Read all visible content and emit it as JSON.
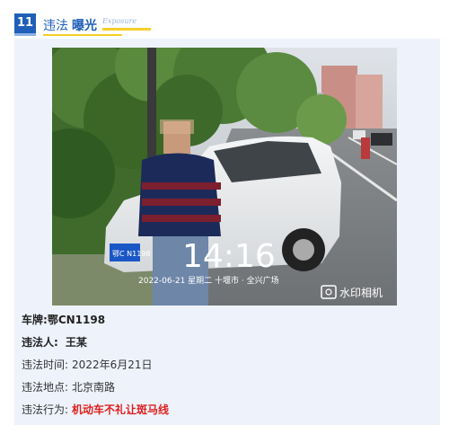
{
  "header": {
    "number": "11",
    "title_part1": "违法",
    "title_part2": "曝光",
    "title_en": "Exposure"
  },
  "photo": {
    "time_overlay": "14:16",
    "date_location": "2022-06-21  星期二  十堰市 · 全兴广场",
    "watermark_app": "水印相机",
    "plate_text": "鄂C N1198"
  },
  "details": {
    "plate_label": "车牌:",
    "plate_value": "鄂CN1198",
    "violator_label": "违法人:",
    "violator_value": "王某",
    "time_label": "违法时间:",
    "time_value": "2022年6月21日",
    "place_label": "违法地点:",
    "place_value": "北京南路",
    "act_label": "违法行为:",
    "act_value": "机动车不礼让斑马线"
  },
  "colors": {
    "brand_blue": "#1f5fb8",
    "accent_yellow": "#f7cf2a",
    "violation_red": "#e0201e",
    "card_bg": "#eef3fb"
  }
}
